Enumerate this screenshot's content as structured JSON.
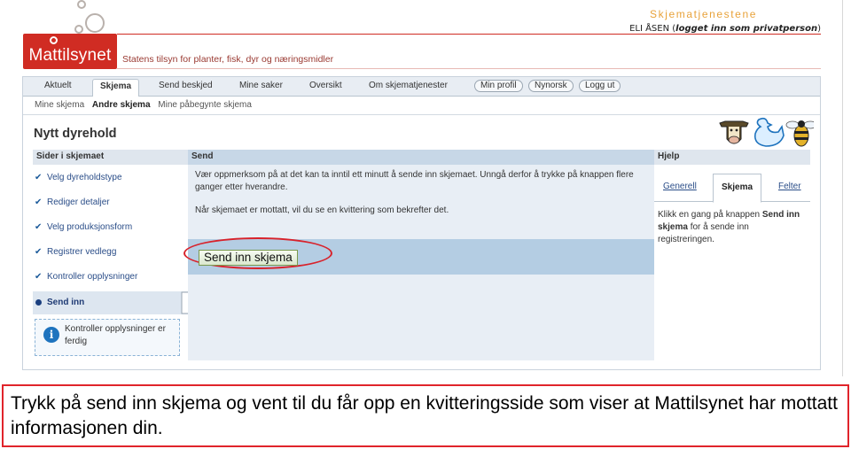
{
  "header": {
    "logo_text": "Mattilsynet",
    "tagline": "Statens tilsyn for planter, fisk, dyr og næringsmidler",
    "service_name": "Skjematjenestene",
    "user_name": "ELI ÅSEN",
    "login_status": "logget inn som privatperson"
  },
  "nav": {
    "tabs": [
      "Aktuelt",
      "Skjema",
      "Send beskjed",
      "Mine saker",
      "Oversikt",
      "Om skjematjenester"
    ],
    "active_tab": "Skjema",
    "pills": [
      "Min profil",
      "Nynorsk",
      "Logg ut"
    ],
    "subnav": [
      "Mine skjema",
      "Andre skjema",
      "Mine påbegynte skjema"
    ]
  },
  "page": {
    "title": "Nytt dyrehold"
  },
  "left": {
    "header": "Sider i skjemaet",
    "steps": [
      "Velg dyreholdstype",
      "Rediger detaljer",
      "Velg produksjonsform",
      "Registrer vedlegg",
      "Kontroller opplysninger",
      "Send inn"
    ],
    "info": "Kontroller opplysninger er ferdig"
  },
  "main": {
    "header": "Send",
    "message1": "Vær oppmerksom på at det kan ta inntil ett minutt å sende inn skjemaet. Unngå derfor å trykke på knappen flere ganger etter hverandre.",
    "message2": "Når skjemaet er mottatt, vil du se en kvittering som bekrefter det.",
    "send_button": "Send inn skjema"
  },
  "help": {
    "header": "Hjelp",
    "tabs": [
      "Generell",
      "Skjema",
      "Felter"
    ],
    "text_prefix": "Klikk en gang på knappen",
    "text_bold": "Send inn skjema",
    "text_suffix": "for å sende inn registreringen."
  },
  "caption": {
    "text": "Trykk på send inn skjema og vent til du får opp en kvitteringsside som viser at Mattilsynet har mottatt informasjonen din."
  },
  "colors": {
    "brand_red": "#d02c23",
    "accent_orange": "#e8a23a",
    "highlight_red": "#d8222b"
  }
}
